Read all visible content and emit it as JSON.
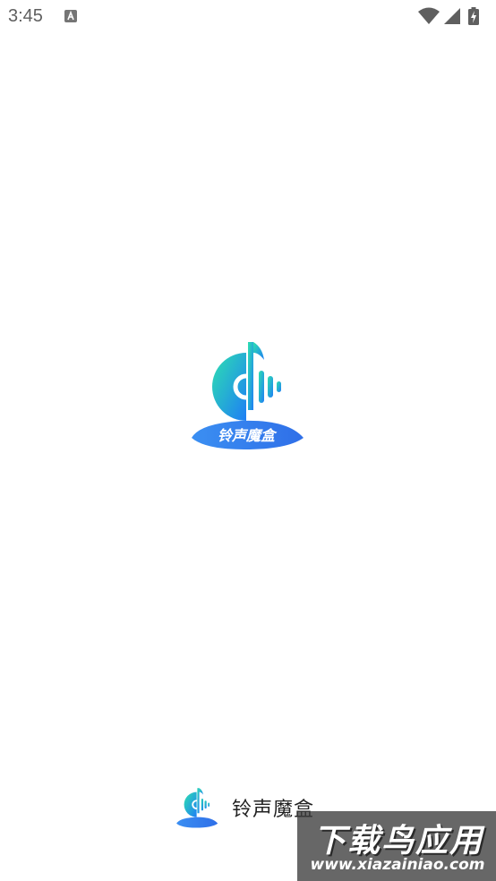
{
  "status_bar": {
    "time": "3:45",
    "notification_icon": "text-a-icon",
    "icons": [
      "wifi-icon",
      "signal-icon",
      "battery-charging-icon"
    ]
  },
  "splash": {
    "logo_icon": "music-note-disc-icon",
    "logo_text": "铃声魔盒"
  },
  "footer": {
    "logo_icon": "app-logo-icon",
    "app_name": "铃声魔盒"
  },
  "watermark": {
    "title": "下载鸟应用",
    "url": "www.xiazainiao.com"
  },
  "colors": {
    "brand_gradient_start": "#2de0b0",
    "brand_gradient_end": "#1e7ef5",
    "banner_blue": "#2f84f0"
  }
}
